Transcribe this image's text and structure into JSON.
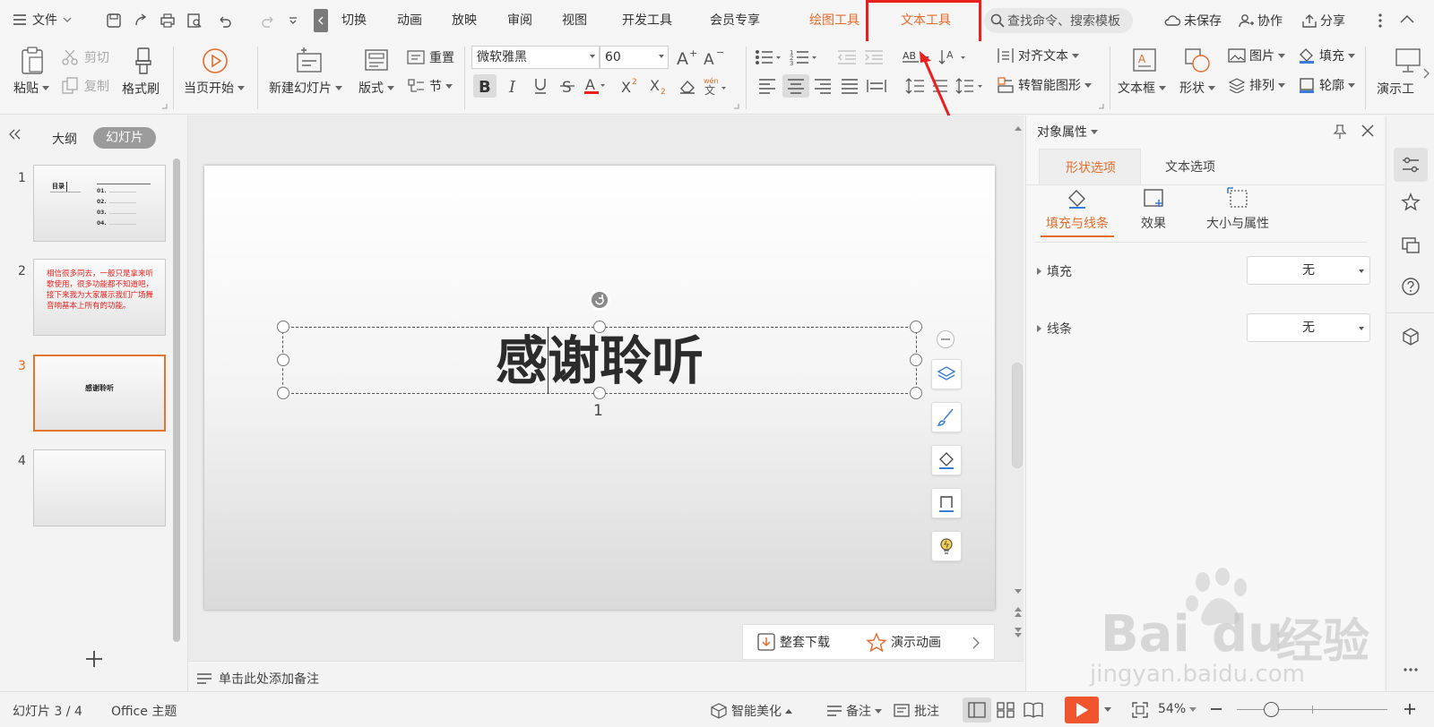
{
  "menubar": {
    "file_label": "文件",
    "tabs": [
      "切换",
      "动画",
      "放映",
      "审阅",
      "视图",
      "开发工具",
      "会员专享"
    ],
    "drawing_tools": "绘图工具",
    "text_tools": "文本工具",
    "search_placeholder": "查找命令、搜索模板",
    "unsaved": "未保存",
    "collaborate": "协作",
    "share": "分享"
  },
  "ribbon": {
    "paste": "粘贴",
    "cut": "剪切",
    "copy": "复制",
    "format_painter": "格式刷",
    "from_current": "当页开始",
    "new_slide": "新建幻灯片",
    "layout": "版式",
    "reset": "重置",
    "section": "节",
    "font_name": "微软雅黑",
    "font_size": "60",
    "align_text": "对齐文本",
    "smart_shape": "转智能图形",
    "textbox": "文本框",
    "shape": "形状",
    "picture": "图片",
    "arrange": "排列",
    "fill": "填充",
    "outline": "轮廓",
    "present": "演示工"
  },
  "leftpanel": {
    "tab_outline": "大纲",
    "tab_slides": "幻灯片",
    "slides": [
      {
        "num": "1",
        "title": "目录",
        "items": [
          "01.",
          "02.",
          "03.",
          "04."
        ]
      },
      {
        "num": "2",
        "text": "相信很多同去，一般只是拿来听歌使用，很多功能都不知道吧，接下来我为大家展示我们广场舞音响基本上所有的功能。"
      },
      {
        "num": "3",
        "title": "感谢聆听"
      },
      {
        "num": "4"
      }
    ]
  },
  "slide": {
    "title": "感谢聆听",
    "number": "1"
  },
  "canvas": {
    "download_all": "整套下载",
    "demo_animation": "演示动画",
    "notes_placeholder": "单击此处添加备注"
  },
  "rpane": {
    "title": "对象属性",
    "tab_shape": "形状选项",
    "tab_text": "文本选项",
    "sub_fill_line": "填充与线条",
    "sub_effects": "效果",
    "sub_size": "大小与属性",
    "fill_label": "填充",
    "fill_value": "无",
    "line_label": "线条",
    "line_value": "无"
  },
  "statusbar": {
    "slide_info": "幻灯片 3 / 4",
    "theme": "Office 主题",
    "beautify": "智能美化",
    "notes": "备注",
    "comments": "批注",
    "zoom": "54%"
  },
  "watermark": {
    "brand": "Bai",
    "brand2": "du",
    "cn": "经验",
    "url": "jingyan.baidu.com"
  },
  "colors": {
    "accent_orange": "#e36c2c",
    "highlight_red": "#e8211e",
    "play_red": "#f0552d"
  }
}
